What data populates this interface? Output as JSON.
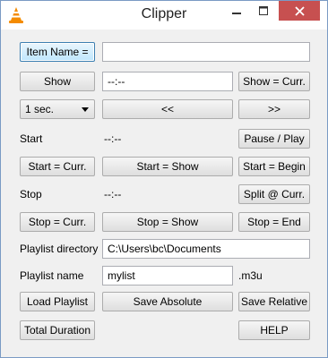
{
  "window": {
    "title": "Clipper",
    "minimize_icon": "minimize-icon",
    "maximize_icon": "maximize-icon",
    "close_icon": "close-icon",
    "app_icon": "vlc-cone-icon",
    "close_color": "#c75050"
  },
  "item": {
    "button": "Item Name =",
    "value": ""
  },
  "show": {
    "button": "Show",
    "value": "--:--",
    "curr_button": "Show = Curr."
  },
  "step": {
    "selected": "1 sec.",
    "back_button": "<<",
    "forward_button": ">>"
  },
  "start": {
    "label": "Start",
    "value": "--:--",
    "pause_button": "Pause / Play",
    "curr_button": "Start = Curr.",
    "show_button": "Start = Show",
    "begin_button": "Start = Begin"
  },
  "stop": {
    "label": "Stop",
    "value": "--:--",
    "split_button": "Split @ Curr.",
    "curr_button": "Stop = Curr.",
    "show_button": "Stop = Show",
    "end_button": "Stop = End"
  },
  "playlist": {
    "directory_label": "Playlist directory",
    "directory_value": "C:\\Users\\bc\\Documents",
    "name_label": "Playlist name",
    "name_value": "mylist",
    "extension": ".m3u",
    "load_button": "Load Playlist",
    "save_absolute_button": "Save Absolute",
    "save_relative_button": "Save Relative"
  },
  "footer": {
    "total_duration_button": "Total Duration",
    "help_button": "HELP"
  }
}
